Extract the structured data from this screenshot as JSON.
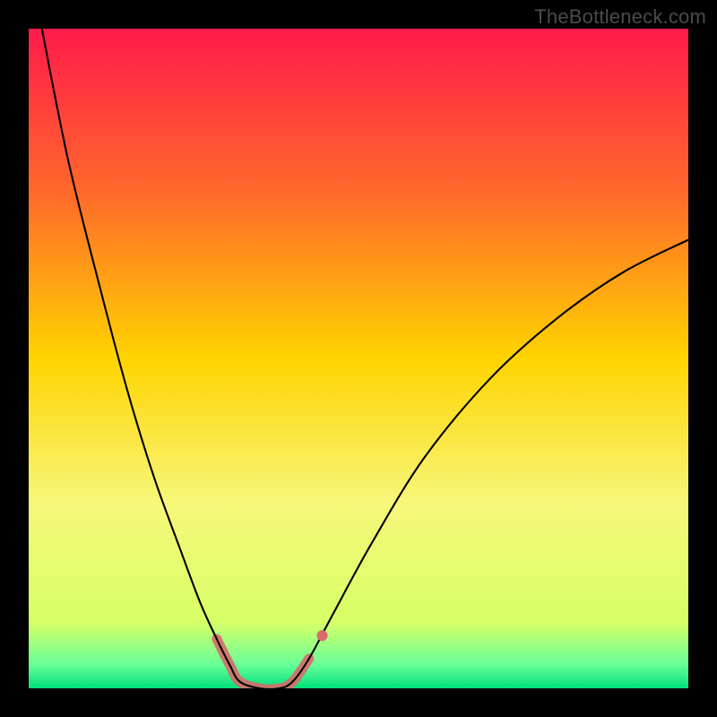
{
  "watermark": "TheBottleneck.com",
  "chart_data": {
    "type": "line",
    "title": "",
    "xlabel": "",
    "ylabel": "",
    "xlim": [
      0,
      100
    ],
    "ylim": [
      0,
      100
    ],
    "gradient_stops": [
      {
        "offset": 0,
        "color": "#ff1a4b"
      },
      {
        "offset": 0.25,
        "color": "#ff6a2a"
      },
      {
        "offset": 0.5,
        "color": "#ffd400"
      },
      {
        "offset": 0.72,
        "color": "#f7f77a"
      },
      {
        "offset": 0.9,
        "color": "#d6ff66"
      },
      {
        "offset": 0.965,
        "color": "#66ff99"
      },
      {
        "offset": 1.0,
        "color": "#00e07a"
      }
    ],
    "series": [
      {
        "name": "bottleneck-curve",
        "color": "#000000",
        "width": 2.1,
        "points_xy": [
          [
            2.0,
            100.0
          ],
          [
            6.0,
            80.0
          ],
          [
            11.0,
            60.0
          ],
          [
            15.0,
            45.0
          ],
          [
            19.0,
            32.0
          ],
          [
            23.0,
            21.0
          ],
          [
            26.0,
            13.0
          ],
          [
            28.5,
            7.5
          ],
          [
            30.5,
            3.5
          ],
          [
            32.0,
            1.0
          ],
          [
            35.0,
            0.0
          ],
          [
            38.0,
            0.0
          ],
          [
            40.0,
            1.0
          ],
          [
            42.5,
            4.5
          ],
          [
            46.0,
            11.0
          ],
          [
            52.0,
            22.0
          ],
          [
            60.0,
            35.0
          ],
          [
            70.0,
            47.0
          ],
          [
            80.0,
            56.0
          ],
          [
            90.0,
            63.0
          ],
          [
            100.0,
            68.0
          ]
        ]
      },
      {
        "name": "highlight-band",
        "color": "#d86a6a",
        "width": 11,
        "opacity": 0.9,
        "linecap": "round",
        "points_xy": [
          [
            28.5,
            7.5
          ],
          [
            30.5,
            3.5
          ],
          [
            32.0,
            1.0
          ],
          [
            35.0,
            0.0
          ],
          [
            38.0,
            0.0
          ],
          [
            40.0,
            1.0
          ],
          [
            42.5,
            4.5
          ]
        ]
      },
      {
        "name": "highlight-marker",
        "type": "scatter",
        "color": "#d86a6a",
        "radius": 6,
        "points_xy": [
          [
            44.5,
            8.0
          ]
        ]
      }
    ]
  }
}
